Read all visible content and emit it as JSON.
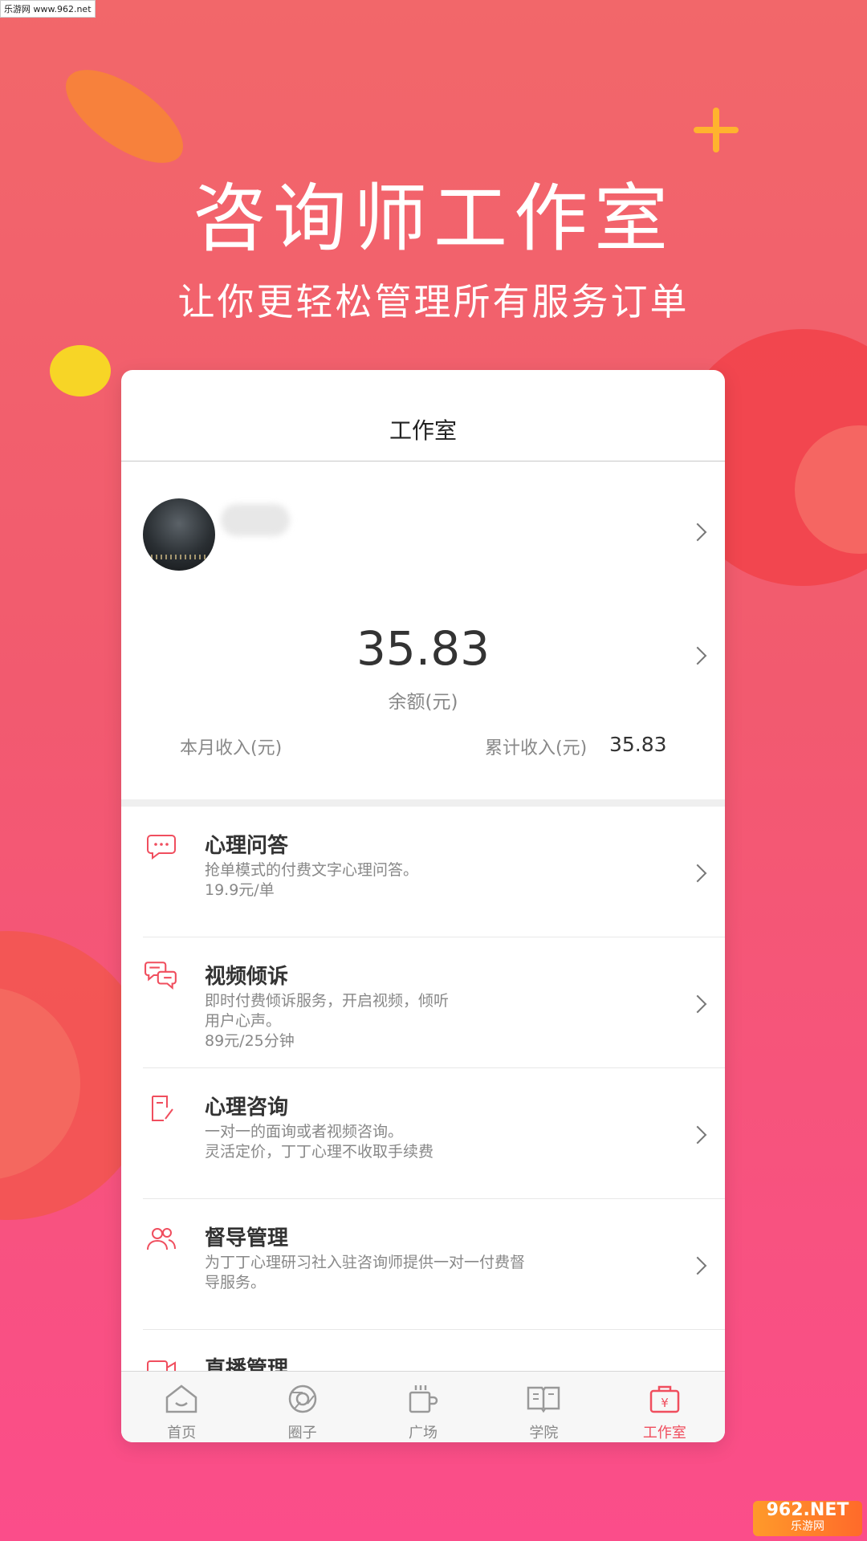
{
  "watermark": {
    "top_left": "乐游网 www.962.net",
    "bottom_right_main": "962.NET",
    "bottom_right_sub": "乐游网"
  },
  "hero": {
    "title": "咨询师工作室",
    "subtitle": "让你更轻松管理所有服务订单"
  },
  "colors": {
    "accent": "#f04e5e",
    "bg_top": "#f2676a",
    "bg_bottom": "#fb4d8a"
  },
  "screen": {
    "nav_title": "工作室",
    "profile": {
      "avatar": "avatar-photo",
      "chevron": "chevron-right-icon"
    },
    "balance": {
      "value": "35.83",
      "label": "余额(元)",
      "month_income_label": "本月收入(元)",
      "total_income_label": "累计收入(元)",
      "total_income_value": "35.83"
    },
    "services": [
      {
        "icon": "chat-bubble-icon",
        "title": "心理问答",
        "desc": [
          "抢单模式的付费文字心理问答。",
          "19.9元/单"
        ]
      },
      {
        "icon": "dual-chat-icon",
        "title": "视频倾诉",
        "desc": [
          "即时付费倾诉服务，开启视频，倾听",
          "用户心声。",
          "89元/25分钟"
        ]
      },
      {
        "icon": "note-edit-icon",
        "title": "心理咨询",
        "desc": [
          "一对一的面询或者视频咨询。",
          "灵活定价，丁丁心理不收取手续费"
        ]
      },
      {
        "icon": "users-icon",
        "title": "督导管理",
        "desc": [
          "为丁丁心理研习社入驻咨询师提供一对一付费督",
          "导服务。"
        ]
      },
      {
        "icon": "video-camera-icon",
        "title": "直播管理",
        "desc": []
      }
    ],
    "tabs": [
      {
        "icon": "home-icon",
        "label": "首页",
        "active": false
      },
      {
        "icon": "circle-icon",
        "label": "圈子",
        "active": false
      },
      {
        "icon": "cup-icon",
        "label": "广场",
        "active": false
      },
      {
        "icon": "book-icon",
        "label": "学院",
        "active": false
      },
      {
        "icon": "wallet-icon",
        "label": "工作室",
        "active": true
      }
    ]
  }
}
